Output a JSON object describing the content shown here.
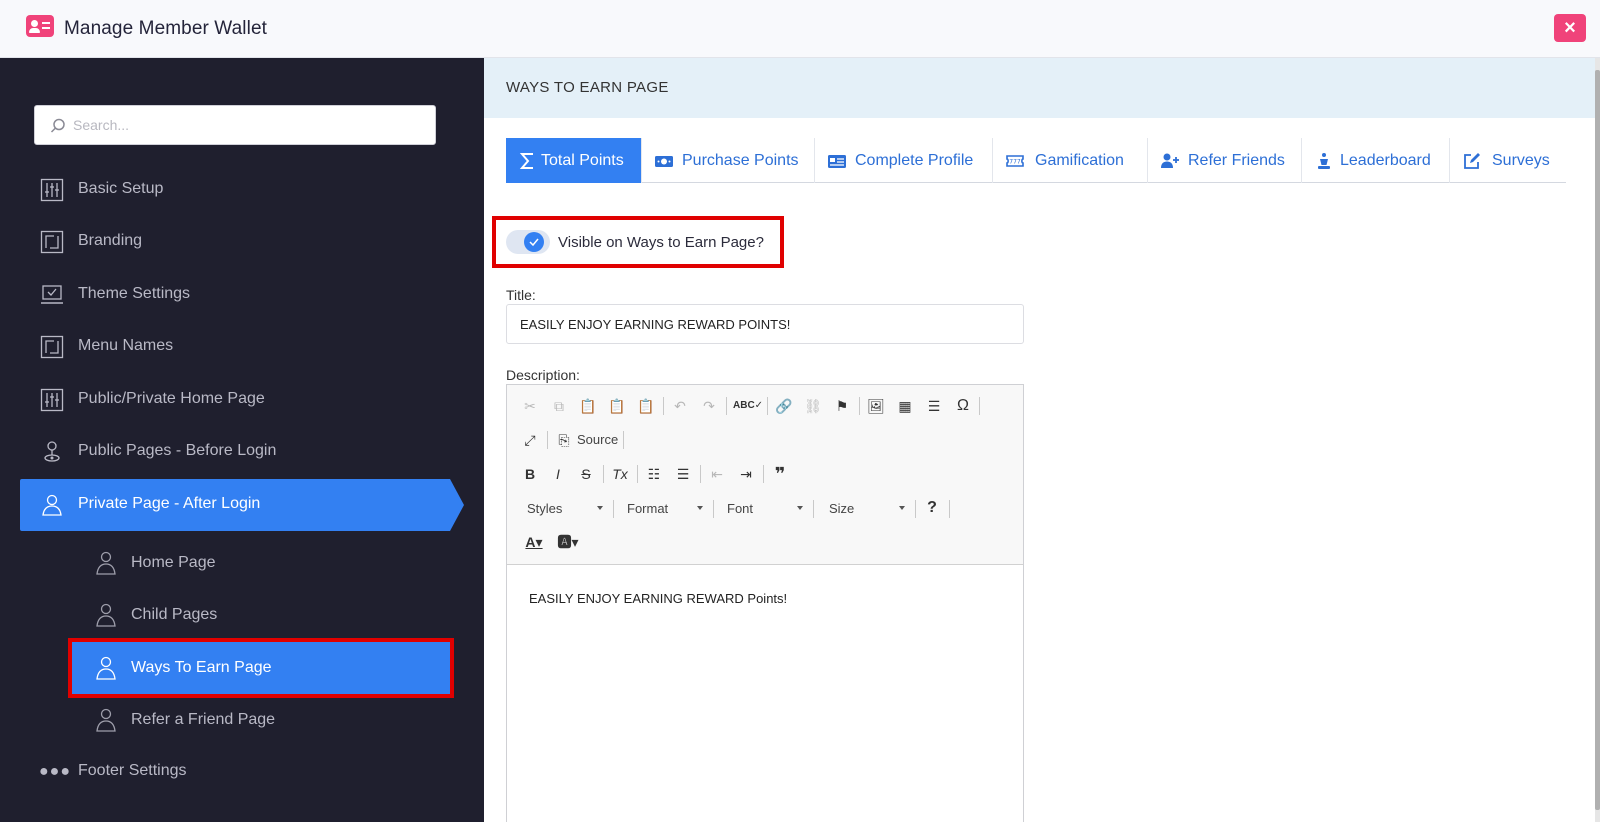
{
  "app": {
    "title": "Manage Member Wallet",
    "close_label": "×"
  },
  "search": {
    "placeholder": "Search..."
  },
  "sidebar": {
    "items": [
      {
        "label": "Basic Setup",
        "icon": "sliders-icon"
      },
      {
        "label": "Branding",
        "icon": "square-frame-icon"
      },
      {
        "label": "Theme Settings",
        "icon": "laptop-check-icon"
      },
      {
        "label": "Menu Names",
        "icon": "square-frame-icon"
      },
      {
        "label": "Public/Private Home Page",
        "icon": "sliders-icon"
      },
      {
        "label": "Public Pages - Before Login",
        "icon": "user-pin-icon"
      },
      {
        "label": "Private Page - After Login",
        "icon": "user-icon"
      }
    ],
    "subitems": [
      {
        "label": "Home Page",
        "icon": "user-icon"
      },
      {
        "label": "Child Pages",
        "icon": "user-icon"
      },
      {
        "label": "Ways To Earn Page",
        "icon": "user-icon"
      },
      {
        "label": "Refer a Friend Page",
        "icon": "user-icon"
      }
    ],
    "footer": {
      "label": "Footer Settings",
      "icon": "dots-icon"
    }
  },
  "main": {
    "section_title": "WAYS TO EARN PAGE",
    "tabs": [
      {
        "label": "Total Points",
        "icon": "sigma-icon"
      },
      {
        "label": "Purchase Points",
        "icon": "money-icon"
      },
      {
        "label": "Complete Profile",
        "icon": "id-card-icon"
      },
      {
        "label": "Gamification",
        "icon": "ticket-icon"
      },
      {
        "label": "Refer Friends",
        "icon": "user-plus-icon"
      },
      {
        "label": "Leaderboard",
        "icon": "chess-icon"
      },
      {
        "label": "Surveys",
        "icon": "edit-icon"
      }
    ],
    "toggle_label": "Visible on Ways to Earn Page?",
    "toggle_on": true,
    "title_label": "Title:",
    "title_value": "EASILY ENJOY EARNING REWARD POINTS!",
    "description_label": "Description:",
    "editor": {
      "source_label": "Source",
      "styles_label": "Styles",
      "format_label": "Format",
      "font_label": "Font",
      "size_label": "Size",
      "help_label": "?",
      "content": "EASILY ENJOY EARNING REWARD Points!"
    }
  },
  "colors": {
    "accent": "#3380f2",
    "danger": "#f0437a",
    "sidebar_bg": "#1f1f2e",
    "highlight": "#e00000"
  }
}
